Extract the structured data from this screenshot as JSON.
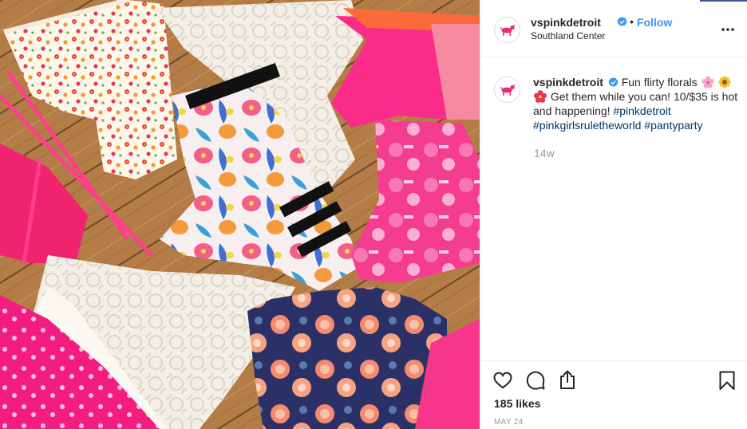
{
  "post": {
    "author": {
      "username": "vspinkdetroit",
      "verified": true,
      "location": "Southland Center",
      "avatar_icon": "pink-dog-logo-icon"
    },
    "follow_label": "Follow",
    "separator": "•",
    "more_icon": "more-options-icon",
    "photo": {
      "icon": "floral-panties-photo"
    },
    "caption": {
      "username": "vspinkdetroit",
      "parts": {
        "t1": "Fun flirty florals",
        "t2": "Get them while you can! 10/$35 is hot and happening!",
        "tag1": "#pinkdetroit",
        "tag2": "#pinkgirlsruletheworld",
        "tag3": "#pantyparty"
      },
      "emojis": [
        "cherry-blossom-emoji",
        "sunflower-emoji",
        "hibiscus-emoji"
      ]
    },
    "time_ago": "14w",
    "likes_text": "185 likes",
    "date_text": "MAY 24",
    "colors": {
      "accent": "#3897f0",
      "hashtag": "#003569",
      "brand_pink": "#ea2b7a",
      "muted": "#999999",
      "border": "#efefef"
    },
    "action_icons": [
      "heart-icon",
      "comment-icon",
      "share-icon",
      "bookmark-icon"
    ]
  }
}
